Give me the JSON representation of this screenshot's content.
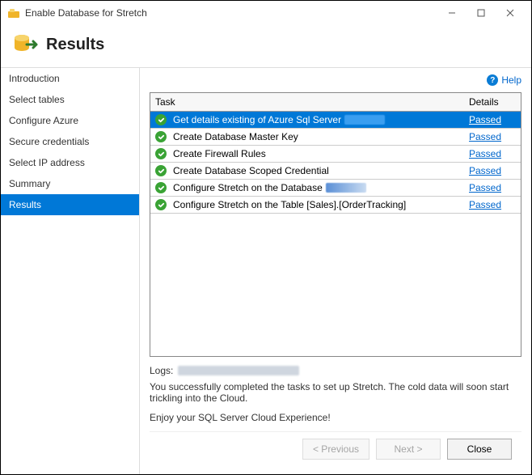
{
  "titlebar": {
    "title": "Enable Database for Stretch"
  },
  "header": {
    "title": "Results"
  },
  "sidebar": {
    "items": [
      {
        "label": "Introduction"
      },
      {
        "label": "Select tables"
      },
      {
        "label": "Configure Azure"
      },
      {
        "label": "Secure credentials"
      },
      {
        "label": "Select IP address"
      },
      {
        "label": "Summary"
      },
      {
        "label": "Results"
      }
    ]
  },
  "help": {
    "label": "Help"
  },
  "grid": {
    "headers": {
      "task": "Task",
      "details": "Details"
    },
    "rows": [
      {
        "task": "Get details existing of Azure Sql Server",
        "blurred_suffix": true,
        "details": "Passed",
        "selected": true
      },
      {
        "task": "Create Database Master Key",
        "details": "Passed"
      },
      {
        "task": "Create Firewall Rules",
        "details": "Passed"
      },
      {
        "task": "Create Database Scoped Credential",
        "details": "Passed"
      },
      {
        "task": "Configure Stretch on the Database",
        "blurred_suffix": true,
        "details": "Passed"
      },
      {
        "task": "Configure Stretch on the Table [Sales].[OrderTracking]",
        "details": "Passed"
      }
    ]
  },
  "logs": {
    "label": "Logs:"
  },
  "messages": {
    "line1": "You successfully completed the tasks to set up Stretch. The cold data will soon start trickling into the Cloud.",
    "line2": "Enjoy your SQL Server Cloud Experience!"
  },
  "footer": {
    "previous": "< Previous",
    "next": "Next >",
    "close": "Close"
  }
}
